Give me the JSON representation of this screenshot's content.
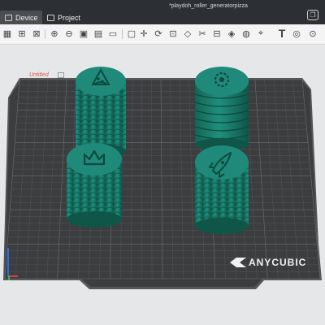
{
  "titlebar": {
    "document_title": "*playdoh_roller_generatorpizza",
    "tabs": [
      {
        "label": "Device",
        "active": true
      },
      {
        "label": "Project",
        "active": false
      }
    ]
  },
  "toolbar": {
    "icons": [
      "add-plate-icon",
      "orient-icon",
      "arrange-icon",
      "zoom-in-icon",
      "zoom-out-icon",
      "split-objects-icon",
      "split-parts-icon",
      "fit-icon",
      "layers-icon",
      "move-icon",
      "rotate-icon",
      "scale-icon",
      "place-on-face-icon",
      "cut-icon",
      "support-paint-icon",
      "seam-paint-icon",
      "color-paint-icon",
      "measure-icon",
      "text-icon",
      "variable-layer-icon",
      "assembly-icon"
    ]
  },
  "plate": {
    "name": "Untitled",
    "brand": "ANYCUBIC"
  },
  "models": [
    {
      "name": "crown-roller"
    },
    {
      "name": "pizza-roller"
    },
    {
      "name": "gear-roller"
    },
    {
      "name": "rocket-roller"
    }
  ],
  "colors": {
    "titlebar": "#2c2f33",
    "plate": "#3b3d3f",
    "grid": "#5b5d5f",
    "model": "#1f8a79",
    "model_dark": "#136555",
    "accent": "#e05550"
  }
}
